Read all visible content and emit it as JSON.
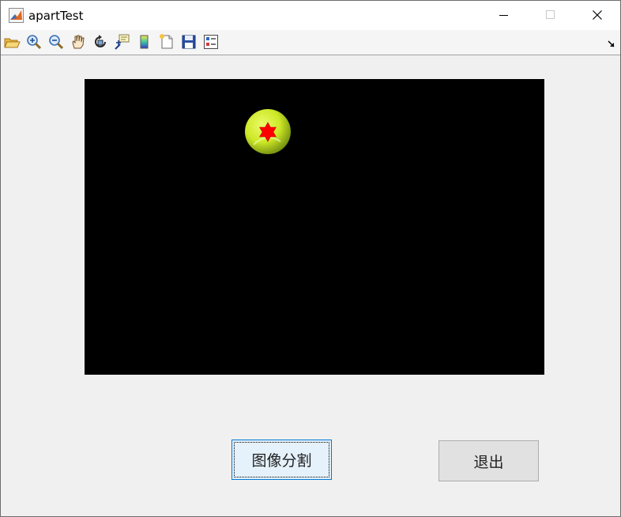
{
  "window": {
    "title": "apartTest",
    "controls": [
      "minimize-icon",
      "maximize-icon",
      "close-icon"
    ]
  },
  "toolbar": {
    "tools": [
      "open-folder-icon",
      "zoom-in-icon",
      "zoom-out-icon",
      "pan-hand-icon",
      "rotate-3d-icon",
      "data-cursor-icon",
      "colorbar-icon",
      "new-figure-icon",
      "save-icon",
      "legend-icon"
    ]
  },
  "image": {
    "background": "#000000",
    "object": "tennis-ball",
    "marker": "red-star"
  },
  "buttons": {
    "segment_label": "图像分割",
    "exit_label": "退出"
  },
  "colors": {
    "accent": "#0078d7",
    "marker": "#ff0000",
    "ball": "#d6f02a"
  }
}
